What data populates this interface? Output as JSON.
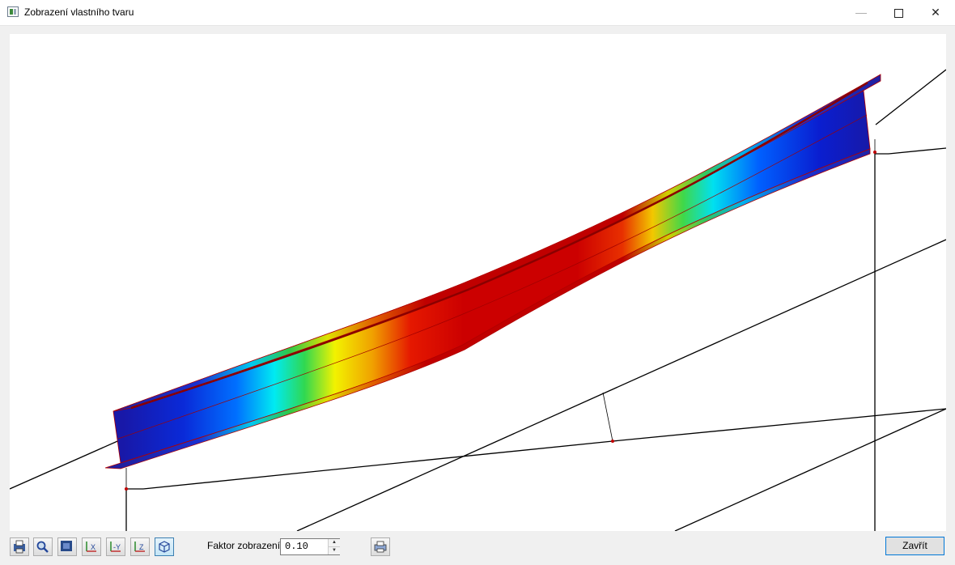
{
  "window": {
    "title": "Zobrazení vlastního tvaru",
    "controls": [
      "minimize",
      "maximize",
      "close"
    ]
  },
  "toolbar": {
    "buttons": [
      {
        "name": "print-view-icon"
      },
      {
        "name": "zoom-icon"
      },
      {
        "name": "render-mode-icon"
      },
      {
        "name": "view-x-icon",
        "label": "X"
      },
      {
        "name": "view-minus-y-icon",
        "label": "-Y"
      },
      {
        "name": "view-z-icon",
        "label": "Z"
      },
      {
        "name": "iso-view-icon",
        "active": true
      }
    ],
    "factor_label": "Faktor zobrazení:",
    "factor_value": "0.10",
    "print_icon": "printer-icon",
    "close_label": "Zavřít"
  },
  "viewport": {
    "colormap": [
      "#1010b0",
      "#0050f0",
      "#00e8f0",
      "#20d040",
      "#f0f000",
      "#f0a000",
      "#e01000",
      "#c80000"
    ],
    "edge_color": "#c00000"
  }
}
